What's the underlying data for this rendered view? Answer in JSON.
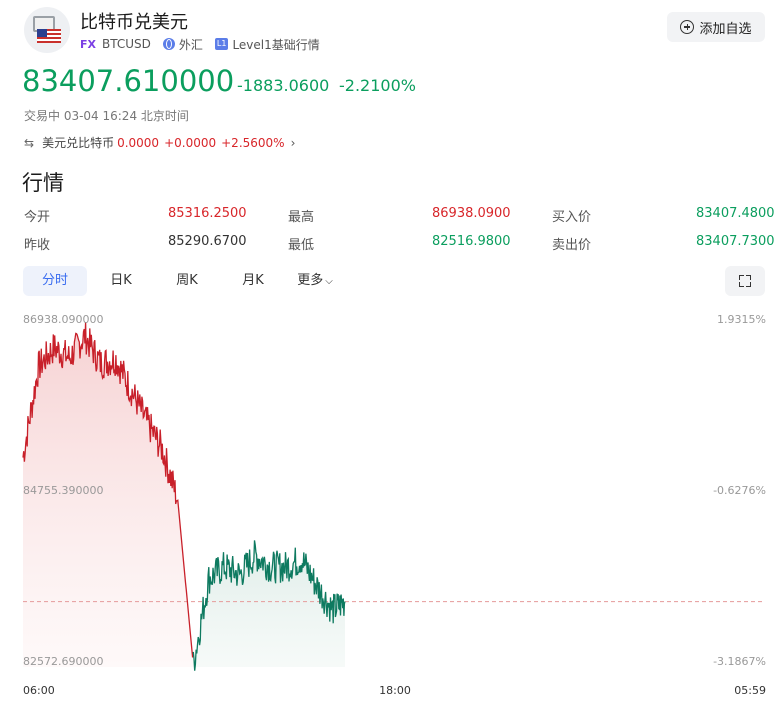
{
  "header": {
    "title": "比特币兑美元",
    "fx_badge": "FX",
    "symbol": "BTCUSD",
    "market": "外汇",
    "level_badge": "L1",
    "level": "Level1基础行情",
    "add_button": "添加自选",
    "icons": [
      "btc-usd-flag-icon",
      "globe-icon",
      "plus-circle-icon"
    ]
  },
  "quote": {
    "price": "83407.610000",
    "change": "-1883.0600",
    "change_pct": "-2.2100%",
    "status": "交易中 03-04 16:24 北京时间"
  },
  "related": {
    "label": "美元兑比特币",
    "price": "0.0000",
    "change": "+0.0000",
    "change_pct": "+2.5600%",
    "icons": [
      "swap-icon",
      "chevron-right-icon"
    ]
  },
  "market_section": {
    "title": "行情",
    "rows": [
      [
        {
          "label": "今开",
          "value": "85316.2500",
          "color": "red"
        },
        {
          "label": "最高",
          "value": "86938.0900",
          "color": "red"
        },
        {
          "label": "买入价",
          "value": "83407.4800",
          "color": "green"
        }
      ],
      [
        {
          "label": "昨收",
          "value": "85290.6700",
          "color": "neutral"
        },
        {
          "label": "最低",
          "value": "82516.9800",
          "color": "green"
        },
        {
          "label": "卖出价",
          "value": "83407.7300",
          "color": "green"
        }
      ]
    ]
  },
  "tabs": [
    "分时",
    "日K",
    "周K",
    "月K",
    "更多"
  ],
  "active_tab": "分时",
  "colors": {
    "up": "#d8262a",
    "down": "#0b9e5e",
    "accent": "#3a6df0",
    "line_up": "#c8202a",
    "line_down": "#0e7a60"
  },
  "chart_data": {
    "type": "line",
    "ylim": [
      82572.69,
      86938.09
    ],
    "left_ticks": [
      "86938.090000",
      "84755.390000",
      "82572.690000"
    ],
    "right_ticks": [
      "1.9315%",
      "-0.6276%",
      "-3.1867%"
    ],
    "x_ticks": [
      "06:00",
      "18:00",
      "05:59"
    ],
    "prev_close": 83407.61,
    "series": [
      {
        "x": [
          "06:00",
          "06:30",
          "07:00",
          "07:30",
          "08:00",
          "08:30",
          "09:00",
          "09:30",
          "10:00",
          "10:30",
          "11:00",
          "11:30",
          "12:00",
          "12:30",
          "13:00",
          "13:30",
          "14:00",
          "14:30",
          "15:00",
          "15:30",
          "16:00",
          "16:24"
        ],
        "values": [
          85250,
          86400,
          86650,
          86520,
          86800,
          86450,
          86500,
          86100,
          85700,
          85350,
          84700,
          82600,
          83700,
          83850,
          83750,
          84000,
          83850,
          83850,
          83950,
          83600,
          83300,
          83407.61
        ]
      }
    ]
  }
}
